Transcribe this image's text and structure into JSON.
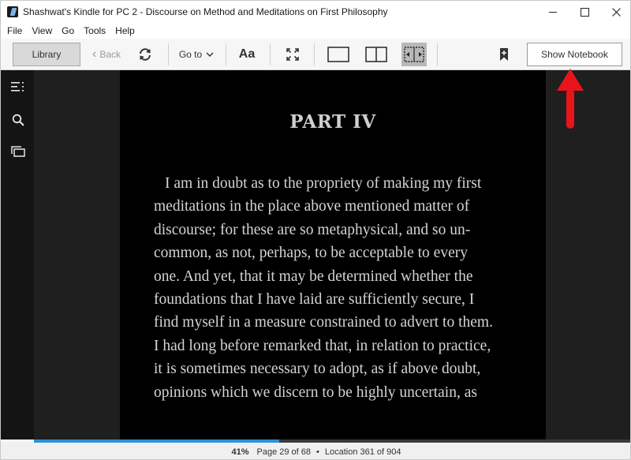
{
  "window": {
    "title": "Shashwat's Kindle for PC 2 - Discourse on Method and Meditations on First Philosophy"
  },
  "menu": [
    "File",
    "View",
    "Go",
    "Tools",
    "Help"
  ],
  "toolbar": {
    "library_label": "Library",
    "back_label": "Back",
    "goto_label": "Go to",
    "font_label": "Aa",
    "show_notebook_label": "Show Notebook"
  },
  "book": {
    "chapter_title": "PART IV",
    "lines": [
      "I am in doubt as to the propriety of making my first",
      "meditations in the place above mentioned matter of",
      "discourse; for these are so metaphysical, and so un-",
      "common, as not, perhaps, to be acceptable to every",
      "one. And yet, that it may be determined whether the",
      "foundations that I have laid are sufficiently secure, I",
      "find myself in a measure constrained to advert to them.",
      "I had long before remarked that, in relation to practice,",
      "it is sometimes necessary to adopt, as if above doubt,",
      "opinions which we discern to be highly uncertain, as"
    ]
  },
  "status": {
    "percent": "41%",
    "page": "Page 29 of 68",
    "location": "Location 361 of 904",
    "progress_fraction": 0.41
  },
  "colors": {
    "progress": "#2e90d9",
    "annotation_arrow": "#e8141a"
  },
  "icons": {
    "sidebar": [
      "table-of-contents-icon",
      "search-icon",
      "flashcards-icon"
    ],
    "toolbar": [
      "back-chevron-icon",
      "sync-icon",
      "chevron-down-icon",
      "fullscreen-icon",
      "single-column-icon",
      "two-column-icon",
      "fit-page-icon",
      "bookmark-add-icon"
    ]
  }
}
